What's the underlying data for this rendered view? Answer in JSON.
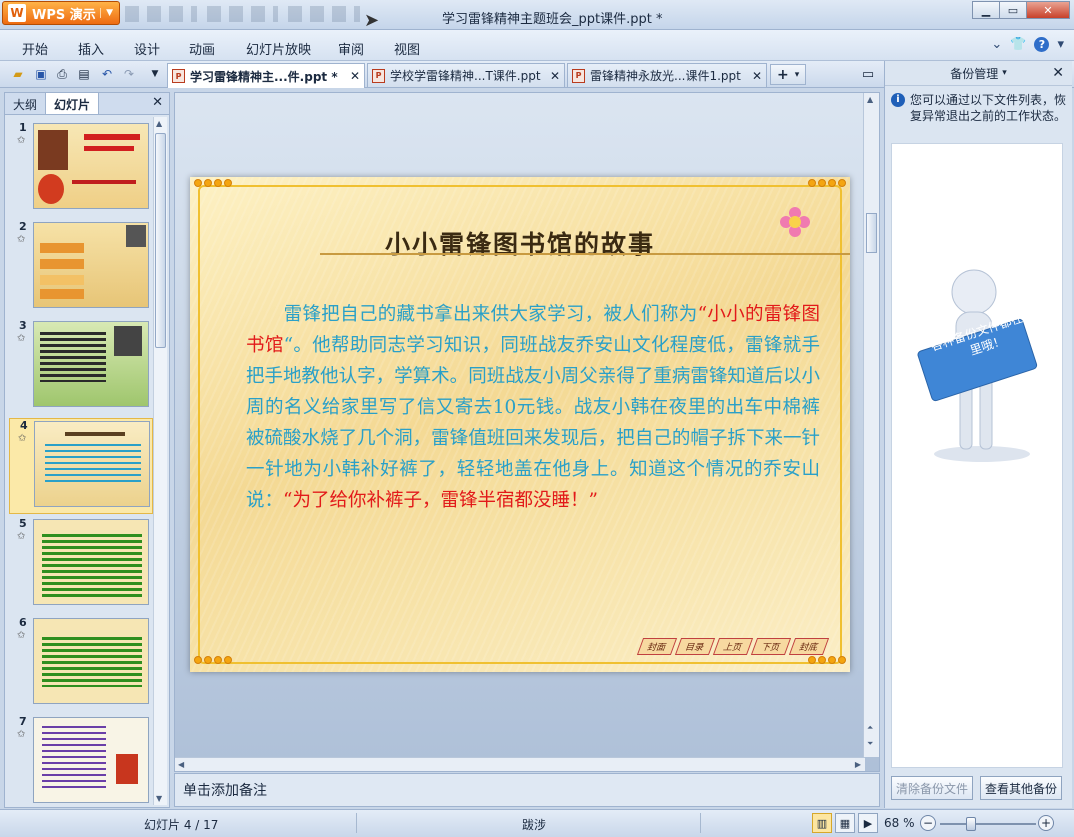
{
  "app": {
    "button_label": "WPS 演示",
    "window_title": "学习雷锋精神主题班会_ppt课件.ppt *"
  },
  "menu": [
    "开始",
    "插入",
    "设计",
    "动画",
    "幻灯片放映",
    "审阅",
    "视图"
  ],
  "doc_tabs": [
    {
      "label": "学习雷锋精神主...件.ppt *",
      "active": true
    },
    {
      "label": "学校学雷锋精神...T课件.ppt",
      "active": false
    },
    {
      "label": "雷锋精神永放光...课件1.ppt",
      "active": false
    }
  ],
  "left_panel": {
    "tabs": [
      "大纲",
      "幻灯片"
    ],
    "active_tab": "幻灯片",
    "thumbnails": [
      "1",
      "2",
      "3",
      "4",
      "5",
      "6",
      "7"
    ],
    "selected": "4"
  },
  "slide": {
    "title": "小小雷锋图书馆的故事",
    "body_part1": "　　雷锋把自己的藏书拿出来供大家学习，被人们称为",
    "body_red1": "“小小的雷锋图书馆",
    "body_part2": "“。他帮助同志学习知识，同班战友乔安山文化程度低，雷锋就手把手地教他认字，学算术。同班战友小周父亲得了重病雷锋知道后以小周的名义给家里写了信又寄去10元钱。战友小韩在夜里的出车中棉裤被硫酸水烧了几个洞，雷锋值班回来发现后，把自己的帽子拆下来一针一针地为小韩补好裤了，轻轻地盖在他身上。知道这个情况的乔安山说：",
    "body_red2": "“为了给你补裤子，雷锋半宿都没睡！”",
    "nav_buttons": [
      "封面",
      "目录",
      "上页",
      "下页",
      "封底"
    ]
  },
  "notes": {
    "placeholder": "单击添加备注"
  },
  "right_panel": {
    "title": "备份管理",
    "info": "您可以通过以下文件列表，恢复异常退出之前的工作状态。",
    "figure_sign": "各种备份文件都在这里哦！",
    "clear_button": "清除备份文件",
    "other_button": "查看其他备份"
  },
  "status": {
    "slide_counter": "幻灯片 4 / 17",
    "theme": "跋涉",
    "zoom": "68 %",
    "zoom_level": 0.68
  },
  "colors": {
    "slide_text": "#2aa0c8",
    "slide_highlight": "#e21a1a",
    "title_text": "#3a2a12",
    "wps_orange": "#ee6b12"
  }
}
